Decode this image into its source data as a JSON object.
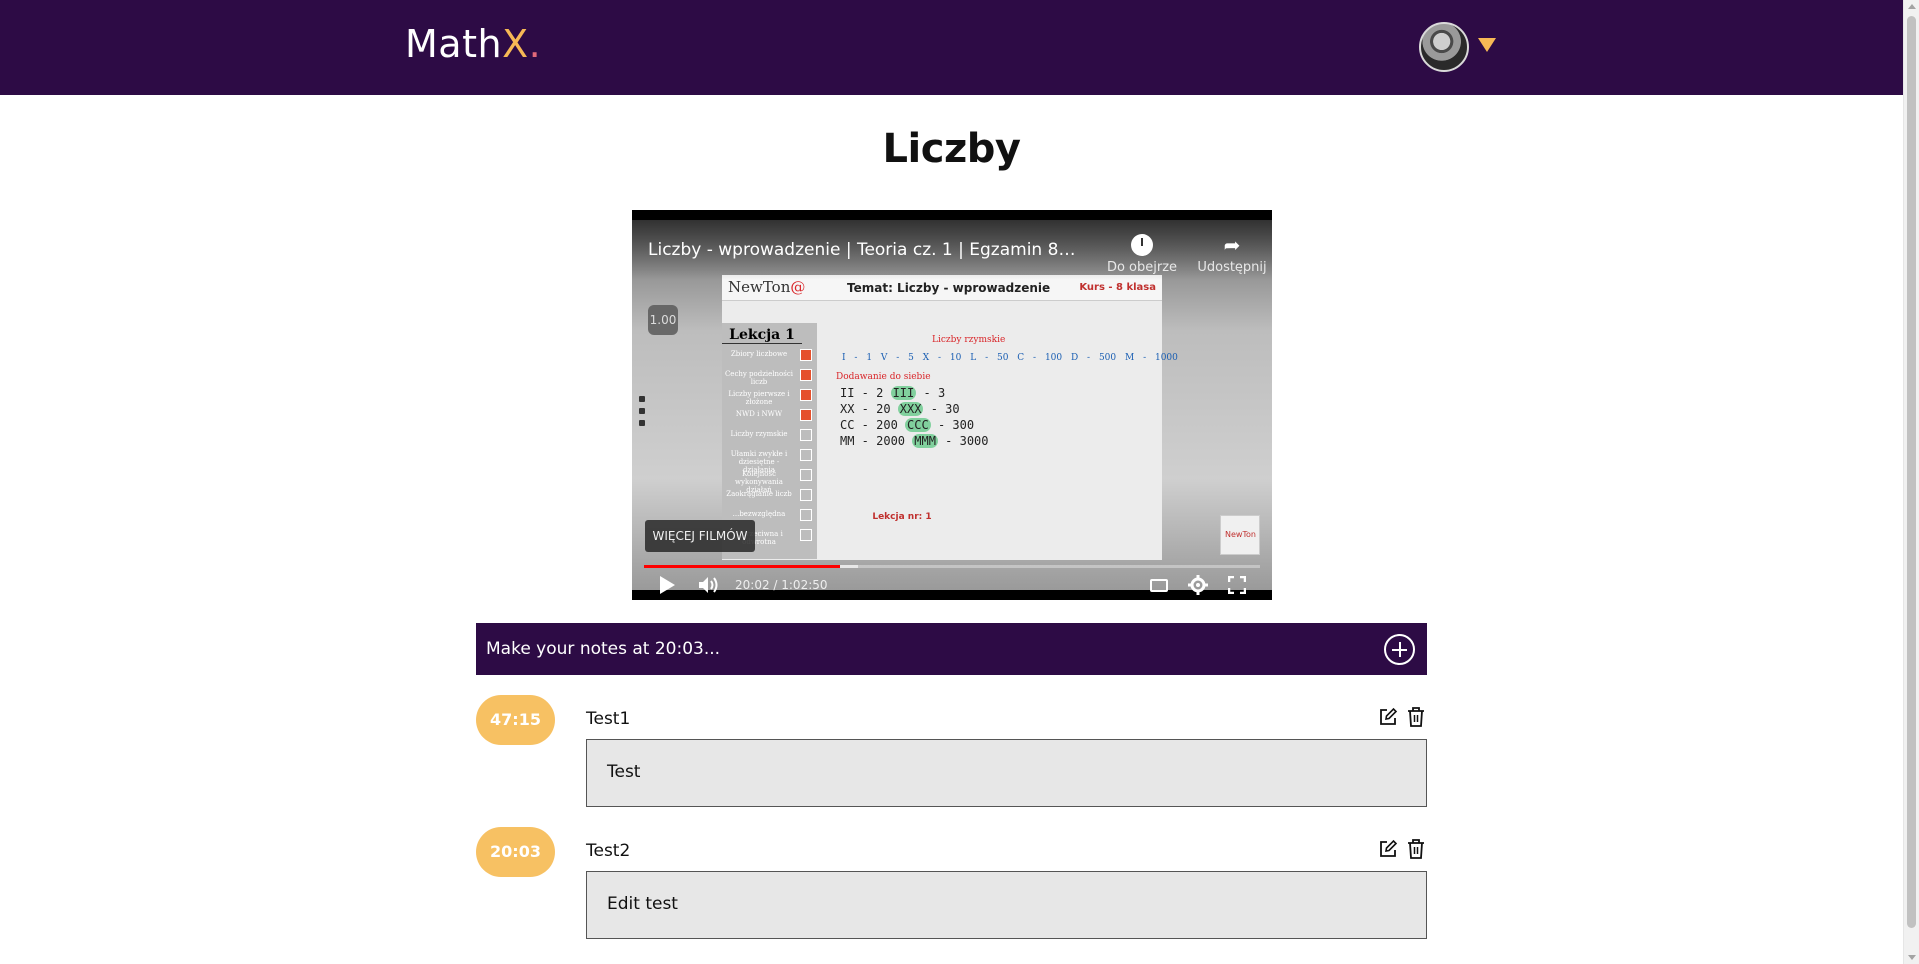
{
  "header": {
    "logo_main": "Math",
    "logo_x": "X",
    "logo_dot": ".",
    "colors": {
      "bar": "#2d0b45",
      "accent": "#f7b955"
    }
  },
  "page": {
    "title": "Liczby"
  },
  "video": {
    "title": "Liczby - wprowadzenie | Teoria cz. 1 | Egzamin 8-kla...",
    "watch_later_label": "Do obejrze",
    "share_label": "Udostępnij",
    "speed": "1.00",
    "more_films_label": "WIĘCEJ FILMÓW",
    "time_display": "20:02 / 1:02:50",
    "progress_fraction": 0.3188,
    "slide": {
      "brand_main": "NewTon",
      "brand_suffix": "@",
      "topic": "Temat: Liczby - wprowadzenie",
      "course": "Kurs - 8 klasa",
      "lesson_title": "Lekcja 1",
      "lessons": [
        {
          "label": "Zbiory liczbowe",
          "done": true
        },
        {
          "label": "Cechy podzielności liczb",
          "done": true
        },
        {
          "label": "Liczby pierwsze i złożone",
          "done": true
        },
        {
          "label": "NWD i NWW",
          "done": true
        },
        {
          "label": "Liczby rzymskie",
          "done": false
        },
        {
          "label": "Ułamki zwykłe i dziesiętne - działania",
          "done": false
        },
        {
          "label": "Kolejność wykonywania działań",
          "done": false
        },
        {
          "label": "Zaokrąglanie liczb",
          "done": false
        },
        {
          "label": "...bezwzględna",
          "done": false
        },
        {
          "label": "...przeciwna i odwrotna",
          "done": false
        }
      ],
      "roman_heading": "Liczby rzymskie",
      "roman_values": "I - 1   V - 5   X - 10   L - 50   C - 100   D - 500   M - 1000",
      "adding_heading": "Dodawanie do siebie",
      "handwriting": [
        {
          "a": "II - 2",
          "b": "III",
          "c": "- 3"
        },
        {
          "a": "XX - 20",
          "b": "XXX",
          "c": "- 30"
        },
        {
          "a": "CC - 200",
          "b": "CCC",
          "c": "- 300"
        },
        {
          "a": "MM - 2000",
          "b": "MMM",
          "c": "- 3000"
        }
      ],
      "lesson_number": "Lekcja nr: 1"
    }
  },
  "notes_bar": {
    "label": "Make your notes at 20:03..."
  },
  "notes": [
    {
      "time": "47:15",
      "title": "Test1",
      "body": "Test"
    },
    {
      "time": "20:03",
      "title": "Test2",
      "body": "Edit test"
    }
  ]
}
